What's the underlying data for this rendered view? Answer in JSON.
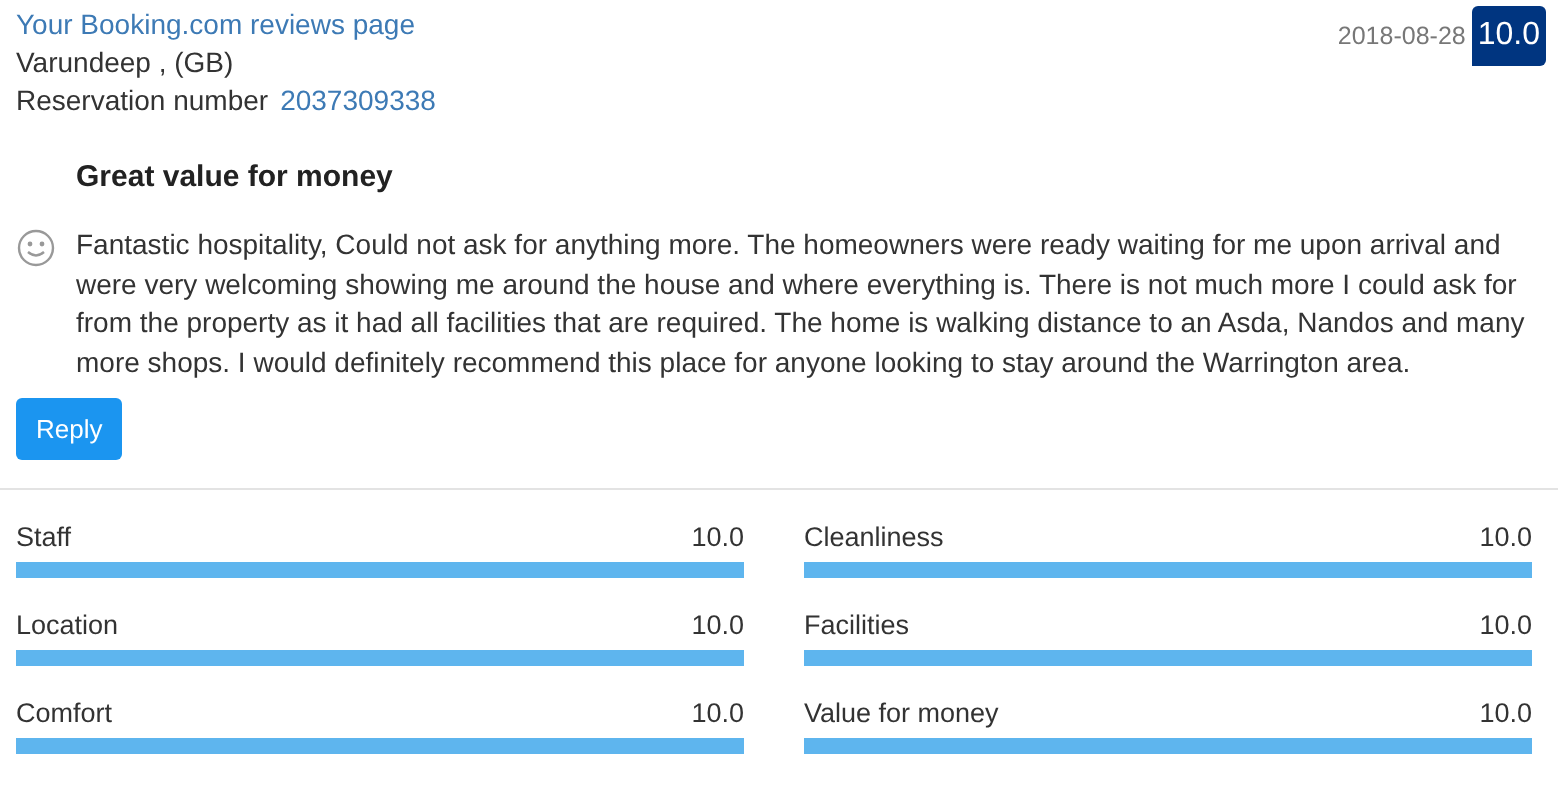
{
  "header": {
    "reviews_link": "Your Booking.com reviews page",
    "guest": "Varundeep , (GB)",
    "reservation_label": "Reservation number",
    "reservation_number": "2037309338",
    "date": "2018-08-28",
    "score": "10.0"
  },
  "review": {
    "title": "Great value for money",
    "text": "Fantastic hospitality, Could not ask for anything more. The homeowners were ready waiting for me upon arrival and were very welcoming showing me around the house and where everything is. There is not much more I could ask for from the property as it had all facilities that are required. The home is walking distance to an Asda, Nandos and many more shops. I would definitely recommend this place for anyone looking to stay around the Warrington area."
  },
  "reply_button": "Reply",
  "scores": [
    {
      "label": "Staff",
      "value": "10.0",
      "level": 1
    },
    {
      "label": "Cleanliness",
      "value": "10.0",
      "level": 1
    },
    {
      "label": "Location",
      "value": "10.0",
      "level": 1
    },
    {
      "label": "Facilities",
      "value": "10.0",
      "level": 1
    },
    {
      "label": "Comfort",
      "value": "10.0",
      "level": 1
    },
    {
      "label": "Value for money",
      "value": "10.0",
      "level": 1
    }
  ]
}
